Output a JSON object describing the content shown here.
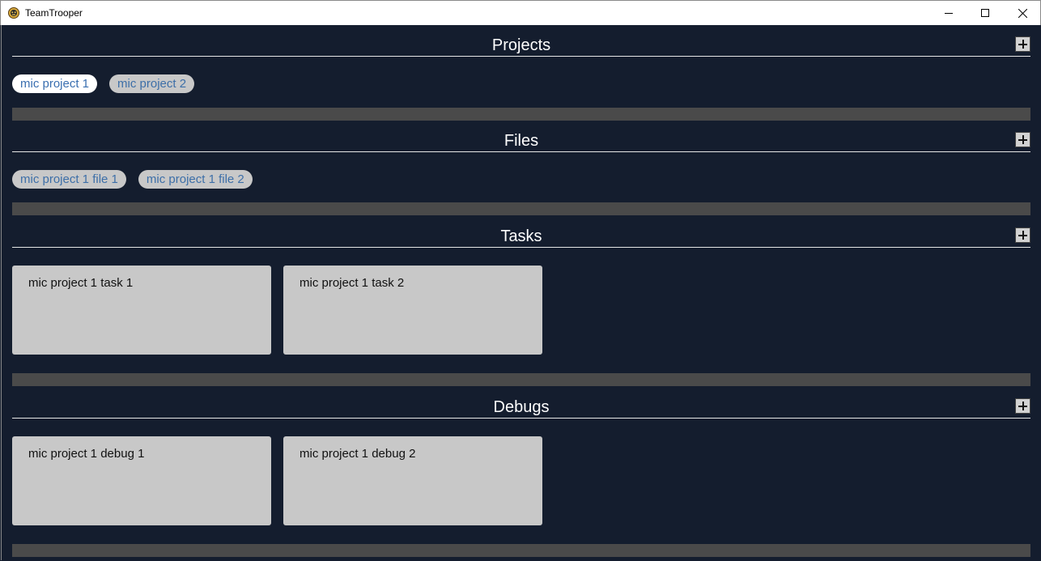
{
  "window": {
    "title": "TeamTrooper",
    "controls": {
      "minimize": "minimize",
      "maximize": "maximize",
      "close": "close"
    }
  },
  "sections": {
    "projects": {
      "title": "Projects",
      "items": [
        {
          "label": "mic project 1",
          "selected": true
        },
        {
          "label": "mic project 2",
          "selected": false
        }
      ]
    },
    "files": {
      "title": "Files",
      "items": [
        {
          "label": "mic project 1 file 1"
        },
        {
          "label": "mic project 1 file 2"
        }
      ]
    },
    "tasks": {
      "title": "Tasks",
      "items": [
        {
          "label": "mic project 1 task 1"
        },
        {
          "label": "mic project 1 task 2"
        }
      ]
    },
    "debugs": {
      "title": "Debugs",
      "items": [
        {
          "label": "mic project 1 debug 1"
        },
        {
          "label": "mic project 1 debug 2"
        }
      ]
    }
  },
  "colors": {
    "background": "#141d2e",
    "divider": "#4a4a4a",
    "chip": "#c8c8c8",
    "chip_selected": "#ffffff",
    "chip_text": "#3d6fa8",
    "card": "#c8c8c8"
  },
  "icons": {
    "app": "trooper-helmet-icon",
    "add": "plus-icon"
  }
}
